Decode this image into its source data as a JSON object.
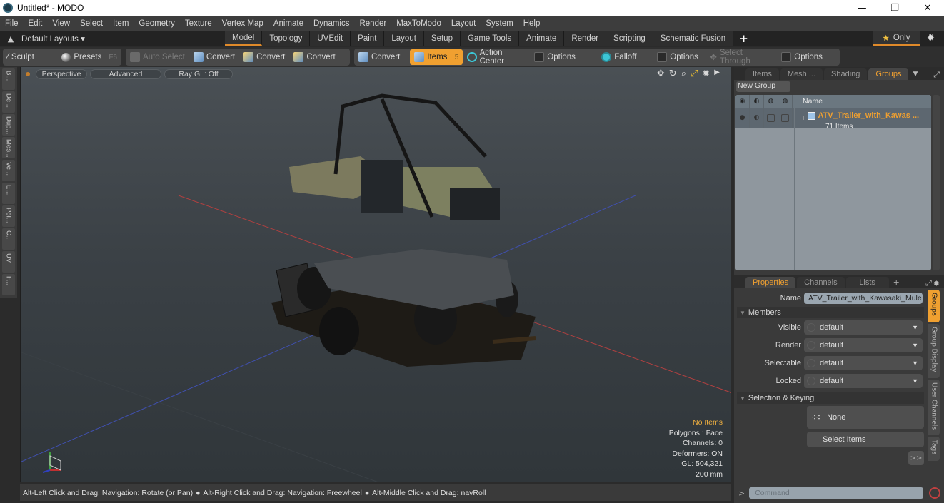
{
  "window": {
    "title": "Untitled* - MODO",
    "controls": [
      "minimize",
      "restore",
      "close"
    ]
  },
  "menubar": {
    "items": [
      "File",
      "Edit",
      "View",
      "Select",
      "Item",
      "Geometry",
      "Texture",
      "Vertex Map",
      "Animate",
      "Dynamics",
      "Render",
      "MaxToModo",
      "Layout",
      "System",
      "Help"
    ]
  },
  "layoutbar": {
    "layouts_label": "Default Layouts",
    "tabs": [
      "Model",
      "Topology",
      "UVEdit",
      "Paint",
      "Layout",
      "Setup",
      "Game Tools",
      "Animate",
      "Render",
      "Scripting",
      "Schematic Fusion"
    ],
    "active_tab": "Model",
    "add_tab": "+",
    "only_label": "Only"
  },
  "toolbar": {
    "sculpt": "Sculpt",
    "presets": "Presets",
    "presets_key": "F6",
    "auto_select": "Auto Select",
    "convert1": "Convert",
    "convert2": "Convert",
    "convert3": "Convert",
    "convert4": "Convert",
    "items": "Items",
    "items_key": "5",
    "action_center": "Action Center",
    "options1": "Options",
    "falloff": "Falloff",
    "options2": "Options",
    "select_through": "Select Through",
    "options3": "Options"
  },
  "left_strip": {
    "tabs": [
      "B...",
      "De...",
      "Dup...",
      "Mes...",
      "Ve...",
      "E...",
      "Pol...",
      "C...",
      "UV",
      "F..."
    ]
  },
  "viewport": {
    "view_mode": "Perspective",
    "shading": "Advanced",
    "raygl": "Ray GL: Off",
    "stats": {
      "selection": "No Items",
      "polygons": "Polygons : Face",
      "channels": "Channels: 0",
      "deformers": "Deformers: ON",
      "gl": "GL: 504,321",
      "grid": "200 mm"
    }
  },
  "statusbar": {
    "hint1": "Alt-Left Click and Drag: Navigation: Rotate (or Pan)",
    "hint2": "Alt-Right Click and Drag: Navigation: Freewheel",
    "hint3": "Alt-Middle Click and Drag: navRoll"
  },
  "groups_panel": {
    "tabs": [
      "Items",
      "Mesh ...",
      "Shading",
      "Groups"
    ],
    "active_tab": "Groups",
    "new_group": "New Group",
    "column_name": "Name",
    "group": {
      "name": "ATV_Trailer_with_Kawas ...",
      "count": "71 Items"
    }
  },
  "properties_panel": {
    "tabs": [
      "Properties",
      "Channels",
      "Lists"
    ],
    "active_tab": "Properties",
    "add_tab": "+",
    "name_label": "Name",
    "name_value": "ATV_Trailer_with_Kawasaki_Mule",
    "members_label": "Members",
    "visible_label": "Visible",
    "visible_value": "default",
    "render_label": "Render",
    "render_value": "default",
    "selectable_label": "Selectable",
    "selectable_value": "default",
    "locked_label": "Locked",
    "locked_value": "default",
    "selection_keying_label": "Selection & Keying",
    "none_label": "None",
    "select_items": "Select Items",
    "more": ">>",
    "side_tabs": [
      "Groups",
      "Group Display",
      "User Channels",
      "Tags"
    ],
    "active_side_tab": "Groups"
  },
  "command": {
    "prompt": ">",
    "placeholder": "Command"
  }
}
